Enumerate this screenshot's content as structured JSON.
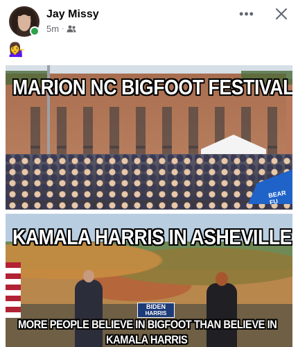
{
  "post": {
    "author": "Jay Missy",
    "time": "5m",
    "separator": "·",
    "audience_icon": "friends-icon",
    "text": "💁‍♀️",
    "more_label": "•••",
    "close_icon": "close-icon"
  },
  "meme": {
    "panel1": {
      "caption": "MARION NC BIGFOOT FESTIVAL",
      "tent_text": "BEAR FU"
    },
    "panel2": {
      "caption_top": "KAMALA HARRIS IN ASHEVILLE",
      "sign_line1": "BIDEN",
      "sign_line2": "HARRIS",
      "caption_bottom_line1": "MORE PEOPLE BELIEVE IN BIGFOOT THAN BELIEVE IN",
      "caption_bottom_line2": "KAMALA HARRIS"
    }
  },
  "colors": {
    "online": "#31a24c",
    "meta_text": "#65676b",
    "sign_blue": "#1d3b78"
  }
}
